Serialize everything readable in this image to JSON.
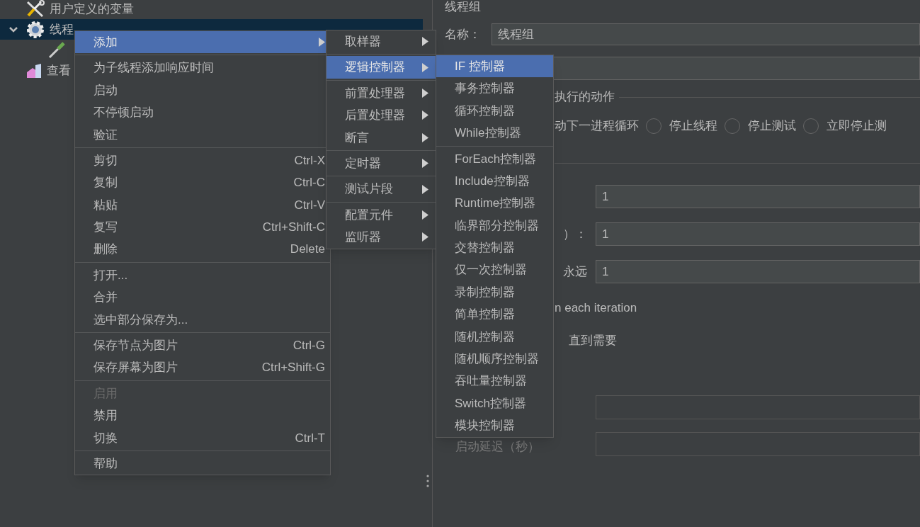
{
  "tree": {
    "items": [
      {
        "kind": "variables",
        "label": "用户定义的变量",
        "selected": false
      },
      {
        "kind": "thread-group",
        "label": "线程",
        "selected": true,
        "expanded": true,
        "children": [
          {
            "kind": "sampler",
            "selected": false
          }
        ]
      },
      {
        "kind": "listener",
        "label": "查看",
        "selected": false
      }
    ]
  },
  "context_menu": {
    "sections": [
      [
        {
          "label": "添加",
          "selected": true,
          "disabled": false,
          "has_submenu": true
        }
      ],
      [
        {
          "label": "为子线程添加响应时间",
          "selected": false,
          "disabled": false,
          "has_submenu": false
        },
        {
          "label": "启动",
          "selected": false,
          "disabled": false,
          "has_submenu": false
        },
        {
          "label": "不停顿启动",
          "selected": false,
          "disabled": false,
          "has_submenu": false
        },
        {
          "label": "验证",
          "selected": false,
          "disabled": false,
          "has_submenu": false
        }
      ],
      [
        {
          "label": "剪切",
          "shortcut": "Ctrl-X",
          "selected": false,
          "disabled": false,
          "has_submenu": false
        },
        {
          "label": "复制",
          "shortcut": "Ctrl-C",
          "selected": false,
          "disabled": false,
          "has_submenu": false
        },
        {
          "label": "粘贴",
          "shortcut": "Ctrl-V",
          "selected": false,
          "disabled": false,
          "has_submenu": false
        },
        {
          "label": "复写",
          "shortcut": "Ctrl+Shift-C",
          "selected": false,
          "disabled": false,
          "has_submenu": false
        },
        {
          "label": "删除",
          "shortcut": "Delete",
          "selected": false,
          "disabled": false,
          "has_submenu": false
        }
      ],
      [
        {
          "label": "打开...",
          "selected": false,
          "disabled": false,
          "has_submenu": false
        },
        {
          "label": "合并",
          "selected": false,
          "disabled": false,
          "has_submenu": false
        },
        {
          "label": "选中部分保存为...",
          "selected": false,
          "disabled": false,
          "has_submenu": false
        }
      ],
      [
        {
          "label": "保存节点为图片",
          "shortcut": "Ctrl-G",
          "selected": false,
          "disabled": false,
          "has_submenu": false
        },
        {
          "label": "保存屏幕为图片",
          "shortcut": "Ctrl+Shift-G",
          "selected": false,
          "disabled": false,
          "has_submenu": false
        }
      ],
      [
        {
          "label": "启用",
          "selected": false,
          "disabled": true,
          "has_submenu": false
        },
        {
          "label": "禁用",
          "selected": false,
          "disabled": false,
          "has_submenu": false
        },
        {
          "label": "切换",
          "shortcut": "Ctrl-T",
          "selected": false,
          "disabled": false,
          "has_submenu": false
        }
      ],
      [
        {
          "label": "帮助",
          "selected": false,
          "disabled": false,
          "has_submenu": false
        }
      ]
    ]
  },
  "add_submenu": {
    "sections": [
      [
        {
          "label": "取样器",
          "selected": false,
          "has_submenu": true
        }
      ],
      [
        {
          "label": "逻辑控制器",
          "selected": true,
          "has_submenu": true
        }
      ],
      [
        {
          "label": "前置处理器",
          "selected": false,
          "has_submenu": true
        },
        {
          "label": "后置处理器",
          "selected": false,
          "has_submenu": true
        },
        {
          "label": "断言",
          "selected": false,
          "has_submenu": true
        }
      ],
      [
        {
          "label": "定时器",
          "selected": false,
          "has_submenu": true
        }
      ],
      [
        {
          "label": "测试片段",
          "selected": false,
          "has_submenu": true
        }
      ],
      [
        {
          "label": "配置元件",
          "selected": false,
          "has_submenu": true
        },
        {
          "label": "监听器",
          "selected": false,
          "has_submenu": true
        }
      ]
    ]
  },
  "controller_submenu": {
    "sections": [
      [
        {
          "label": "IF 控制器",
          "selected": true
        },
        {
          "label": "事务控制器",
          "selected": false
        },
        {
          "label": "循环控制器",
          "selected": false
        },
        {
          "label": "While控制器",
          "selected": false
        }
      ],
      [
        {
          "label": "ForEach控制器",
          "selected": false
        },
        {
          "label": "Include控制器",
          "selected": false
        },
        {
          "label": "Runtime控制器",
          "selected": false
        },
        {
          "label": "临界部分控制器",
          "selected": false
        },
        {
          "label": "交替控制器",
          "selected": false
        },
        {
          "label": "仅一次控制器",
          "selected": false
        },
        {
          "label": "录制控制器",
          "selected": false
        },
        {
          "label": "简单控制器",
          "selected": false
        },
        {
          "label": "随机控制器",
          "selected": false
        },
        {
          "label": "随机顺序控制器",
          "selected": false
        },
        {
          "label": "吞吐量控制器",
          "selected": false
        },
        {
          "label": "Switch控制器",
          "selected": false
        },
        {
          "label": "模块控制器",
          "selected": false
        }
      ]
    ]
  },
  "form": {
    "title": "线程组",
    "name_label": "名称：",
    "name_value": "线程组",
    "action_group_label": "执行的动作",
    "action_partial": "动下一进程循环",
    "radios": [
      {
        "label": "停止线程",
        "selected": false
      },
      {
        "label": "停止测试",
        "selected": false
      },
      {
        "label": "立即停止测",
        "selected": false
      }
    ],
    "fields": [
      {
        "value": "1"
      },
      {
        "label": "）：",
        "value": "1"
      },
      {
        "label": "永远",
        "value": "1"
      }
    ],
    "iteration_text": "n each iteration",
    "delay_text": "直到需要",
    "lower_fields": [
      {
        "disabled": true
      },
      {
        "label": "启动延迟（秒）",
        "disabled": true
      }
    ]
  }
}
